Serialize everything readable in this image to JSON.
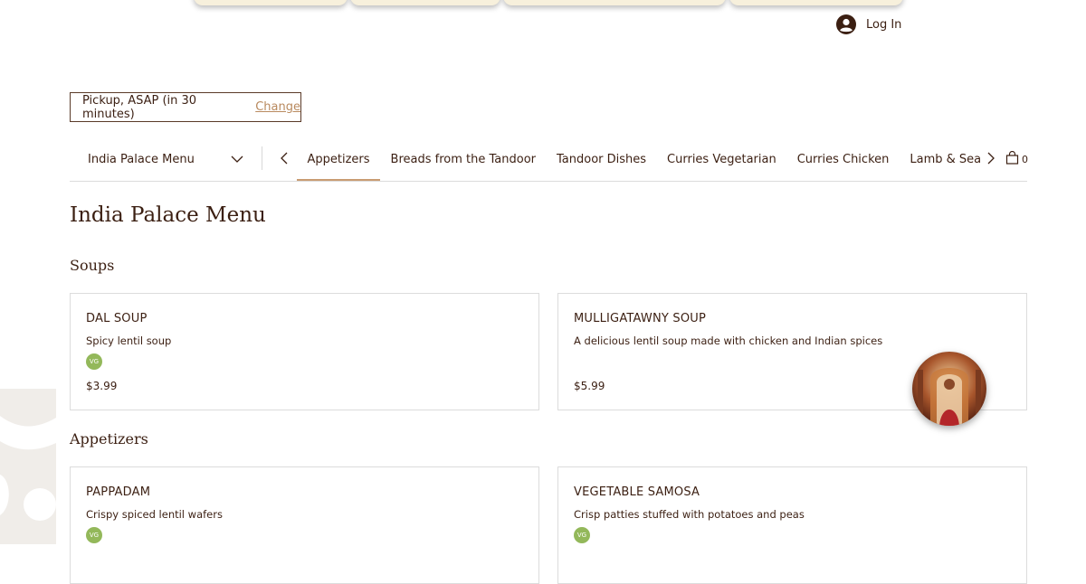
{
  "header": {
    "login_label": "Log In"
  },
  "pickup": {
    "text": "Pickup, ASAP (in 30 minutes)",
    "change_label": "Change"
  },
  "menu_nav": {
    "selected_menu": "India Palace Menu",
    "tabs": [
      {
        "label": "Appetizers",
        "active": true
      },
      {
        "label": "Breads from the Tandoor",
        "active": false
      },
      {
        "label": "Tandoor Dishes",
        "active": false
      },
      {
        "label": "Curries Vegetarian",
        "active": false
      },
      {
        "label": "Curries Chicken",
        "active": false
      },
      {
        "label": "Lamb & Sea Food Curries",
        "active": false
      }
    ],
    "cart_count": "0"
  },
  "page_title": "India Palace Menu",
  "sections": [
    {
      "title": "Soups",
      "items": [
        {
          "name": "DAL SOUP",
          "description": "Spicy lentil soup",
          "badge": "VG",
          "price": "$3.99"
        },
        {
          "name": "MULLIGATAWNY SOUP",
          "description": "A delicious lentil soup made with chicken and Indian spices",
          "price": "$5.99"
        }
      ]
    },
    {
      "title": "Appetizers",
      "items": [
        {
          "name": "PAPPADAM",
          "description": "Crispy spiced lentil wafers",
          "badge": "VG"
        },
        {
          "name": "VEGETABLE SAMOSA",
          "description": "Crisp patties stuffed with potatoes and peas",
          "badge": "VG"
        }
      ]
    }
  ],
  "colors": {
    "text": "#3b1f12",
    "accent": "#c99c72",
    "vegan_badge": "#93b85a"
  }
}
